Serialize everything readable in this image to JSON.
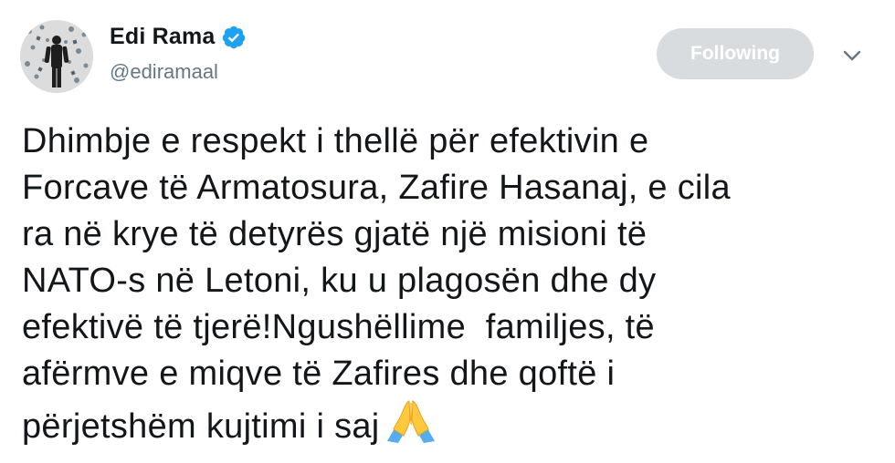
{
  "author": {
    "name": "Edi Rama",
    "handle": "@ediramaal",
    "verified_icon": "verified-badge-icon",
    "verified_color": "#1da1f2"
  },
  "actions": {
    "follow_label": "Following",
    "follow_button_color": "#d9dcdf",
    "menu_icon": "chevron-down-icon"
  },
  "tweet": {
    "lines": [
      "Dhimbje e respekt i thellë për efektivin e",
      "Forcave të Armatosura, Zafire Hasanaj, e cila",
      "ra në krye të detyrës gjatë një misioni të",
      "NATO-s në Letoni, ku u plagosën dhe dy",
      "efektivë të tjerë!Ngushëllime  familjes, të",
      "afërmve e miqve të Zafires dhe qoftë i",
      "përjetshëm kujtimi i saj"
    ],
    "emoji_icon": "folded-hands-icon"
  }
}
